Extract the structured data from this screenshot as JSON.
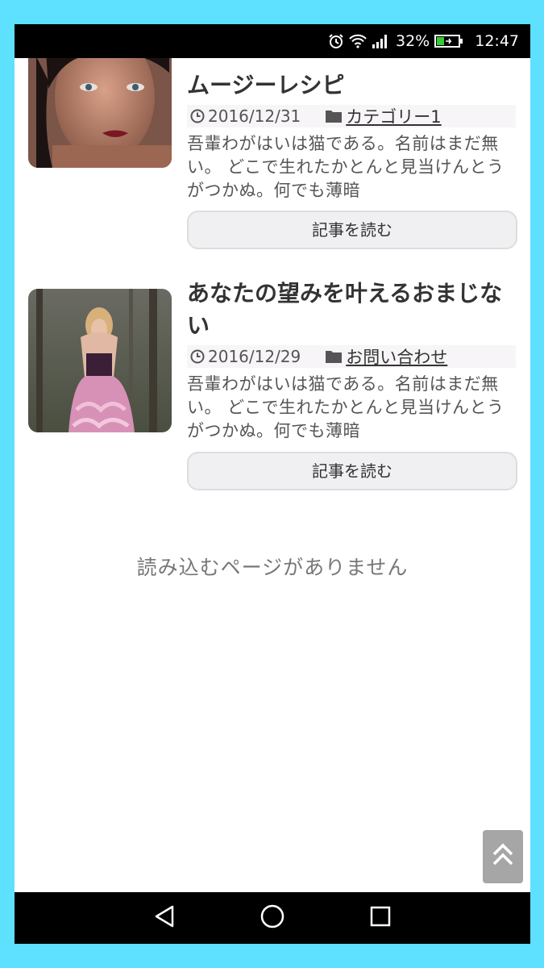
{
  "status_bar": {
    "battery_percent": "32%",
    "time": "12:47"
  },
  "articles": [
    {
      "title": "忙しい朝でも簡単にできるスムージーレシピ",
      "title_visible": "ムージーレシピ",
      "date": "2016/12/31",
      "category": "カテゴリー1",
      "excerpt": "吾輩わがはいは猫である。名前はまだ無い。 どこで生れたかとんと見当けんとうがつかぬ。何でも薄暗",
      "read_button": "記事を読む"
    },
    {
      "title": "あなたの望みを叶えるおまじない",
      "date": "2016/12/29",
      "category": "お問い合わせ",
      "excerpt": "吾輩わがはいは猫である。名前はまだ無い。 どこで生れたかとんと見当けんとうがつかぬ。何でも薄暗",
      "read_button": "記事を読む"
    }
  ],
  "no_more_pages": "読み込むページがありません",
  "icons": {
    "clock": "clock-icon",
    "folder": "folder-icon",
    "back_to_top": "double-chevron-up-icon",
    "nav_back": "triangle-back-icon",
    "nav_home": "circle-home-icon",
    "nav_recents": "square-recents-icon"
  },
  "colors": {
    "frame": "#5ee0ff",
    "text_dark": "#333333",
    "button_bg": "#f0eff2",
    "totop_bg": "#a6a6a6"
  }
}
